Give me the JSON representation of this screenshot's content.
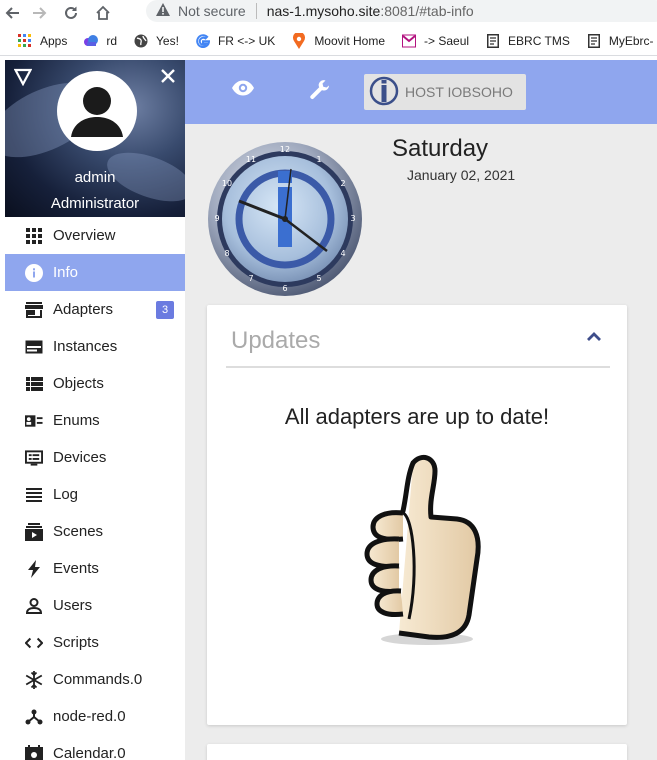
{
  "browser": {
    "security_label": "Not secure",
    "url_host": "nas-1.mysoho.site",
    "url_path": ":8081/#tab-info",
    "bookmarks": [
      "Apps",
      "rd",
      "Yes!",
      "FR <-> UK",
      "Moovit Home",
      "-> Saeul",
      "EBRC TMS",
      "MyEbrc-"
    ]
  },
  "sidebar": {
    "user_name": "admin",
    "user_role": "Administrator",
    "items": [
      {
        "label": "Overview",
        "icon": "grid-icon"
      },
      {
        "label": "Info",
        "icon": "info-icon"
      },
      {
        "label": "Adapters",
        "icon": "store-icon",
        "badge": "3"
      },
      {
        "label": "Instances",
        "icon": "instances-icon"
      },
      {
        "label": "Objects",
        "icon": "list-icon"
      },
      {
        "label": "Enums",
        "icon": "enums-icon"
      },
      {
        "label": "Devices",
        "icon": "devices-icon"
      },
      {
        "label": "Log",
        "icon": "log-icon"
      },
      {
        "label": "Scenes",
        "icon": "scenes-icon"
      },
      {
        "label": "Events",
        "icon": "bolt-icon"
      },
      {
        "label": "Users",
        "icon": "user-icon"
      },
      {
        "label": "Scripts",
        "icon": "code-icon"
      },
      {
        "label": "Commands.0",
        "icon": "snowflake-icon"
      },
      {
        "label": "node-red.0",
        "icon": "nodes-icon"
      },
      {
        "label": "Calendar.0",
        "icon": "calendar-icon"
      }
    ]
  },
  "toolbar": {
    "host_label": "HOST IOBSOHO"
  },
  "info": {
    "day": "Saturday",
    "date": "January 02, 2021",
    "updates_title": "Updates",
    "updates_message": "All adapters are up to date!"
  },
  "colors": {
    "accent": "#8fa6ee",
    "badge": "#6b7be0",
    "main_bg": "#ececec"
  }
}
